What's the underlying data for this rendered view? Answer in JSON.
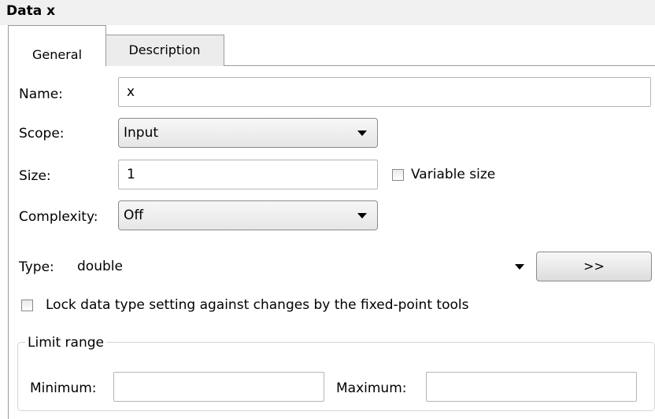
{
  "window": {
    "title": "Data x"
  },
  "tabs": [
    {
      "label": "General",
      "active": true
    },
    {
      "label": "Description",
      "active": false
    }
  ],
  "general": {
    "name": {
      "label": "Name:",
      "value": "x"
    },
    "scope": {
      "label": "Scope:",
      "value": "Input"
    },
    "size": {
      "label": "Size:",
      "value": "1"
    },
    "variable_size": {
      "label": "Variable size",
      "checked": false
    },
    "complexity": {
      "label": "Complexity:",
      "value": "Off"
    },
    "type": {
      "label": "Type:",
      "value": "double",
      "button_label": ">>"
    },
    "lock_data_type": {
      "label": "Lock data type setting against changes by the fixed-point tools",
      "checked": false
    },
    "limit_range": {
      "legend": "Limit range",
      "minimum": {
        "label": "Minimum:",
        "value": ""
      },
      "maximum": {
        "label": "Maximum:",
        "value": ""
      }
    }
  },
  "colors": {
    "border": "#9a9a9a",
    "title_bar": "#f0f0f0",
    "tab_inactive": "#ececec"
  }
}
